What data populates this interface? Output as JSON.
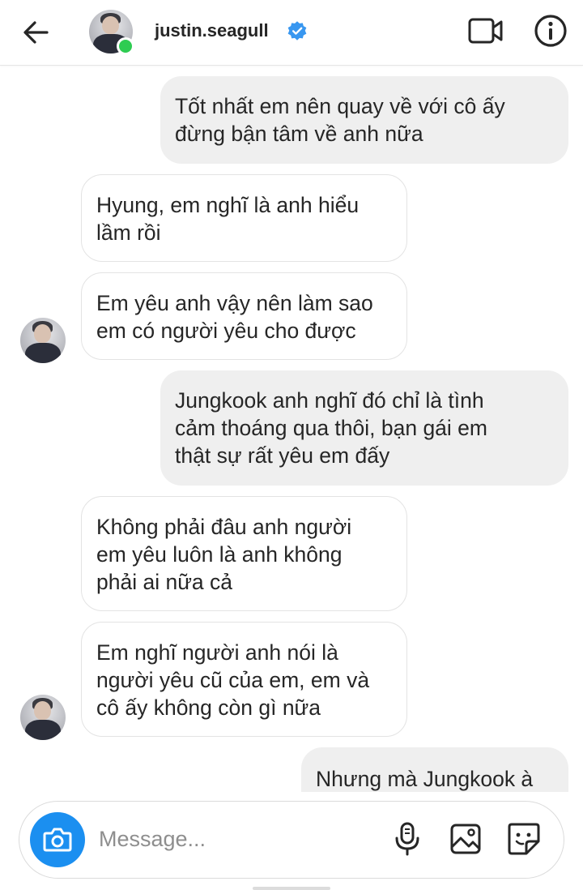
{
  "header": {
    "username": "justin.seagull",
    "icons": {
      "back": "arrow-left-icon",
      "verified": "verified-badge-icon",
      "video": "video-call-icon",
      "info": "info-icon"
    },
    "online_color": "#2ecc52",
    "verified_color": "#3897f0"
  },
  "messages": [
    {
      "direction": "outgoing",
      "text": "Tốt nhất em nên quay về với cô ấy\nđừng bận tâm về anh nữa"
    },
    {
      "direction": "incoming",
      "text": "Hyung, em nghĩ là anh hiểu\nlầm rồi"
    },
    {
      "direction": "incoming",
      "text": "Em yêu anh vậy nên làm sao\nem có người yêu cho được",
      "avatar": true
    },
    {
      "direction": "outgoing",
      "text": "Jungkook anh nghĩ đó chỉ là tình\ncảm thoáng qua thôi, bạn gái em\nthật sự rất yêu em đấy"
    },
    {
      "direction": "incoming",
      "text": "Không phải đâu anh người\nem yêu luôn là anh không\nphải ai nữa cả"
    },
    {
      "direction": "incoming",
      "text": "Em nghĩ người anh nói là\nngười yêu cũ của em, em và\ncô ấy không còn gì nữa",
      "avatar": true
    },
    {
      "direction": "outgoing",
      "text": "Nhưng mà Jungkook à"
    }
  ],
  "composer": {
    "placeholder": "Message...",
    "value": "",
    "icons": {
      "camera": "camera-icon",
      "mic": "microphone-icon",
      "gallery": "image-gallery-icon",
      "sticker": "sticker-icon"
    },
    "camera_color": "#1b8ff0"
  }
}
